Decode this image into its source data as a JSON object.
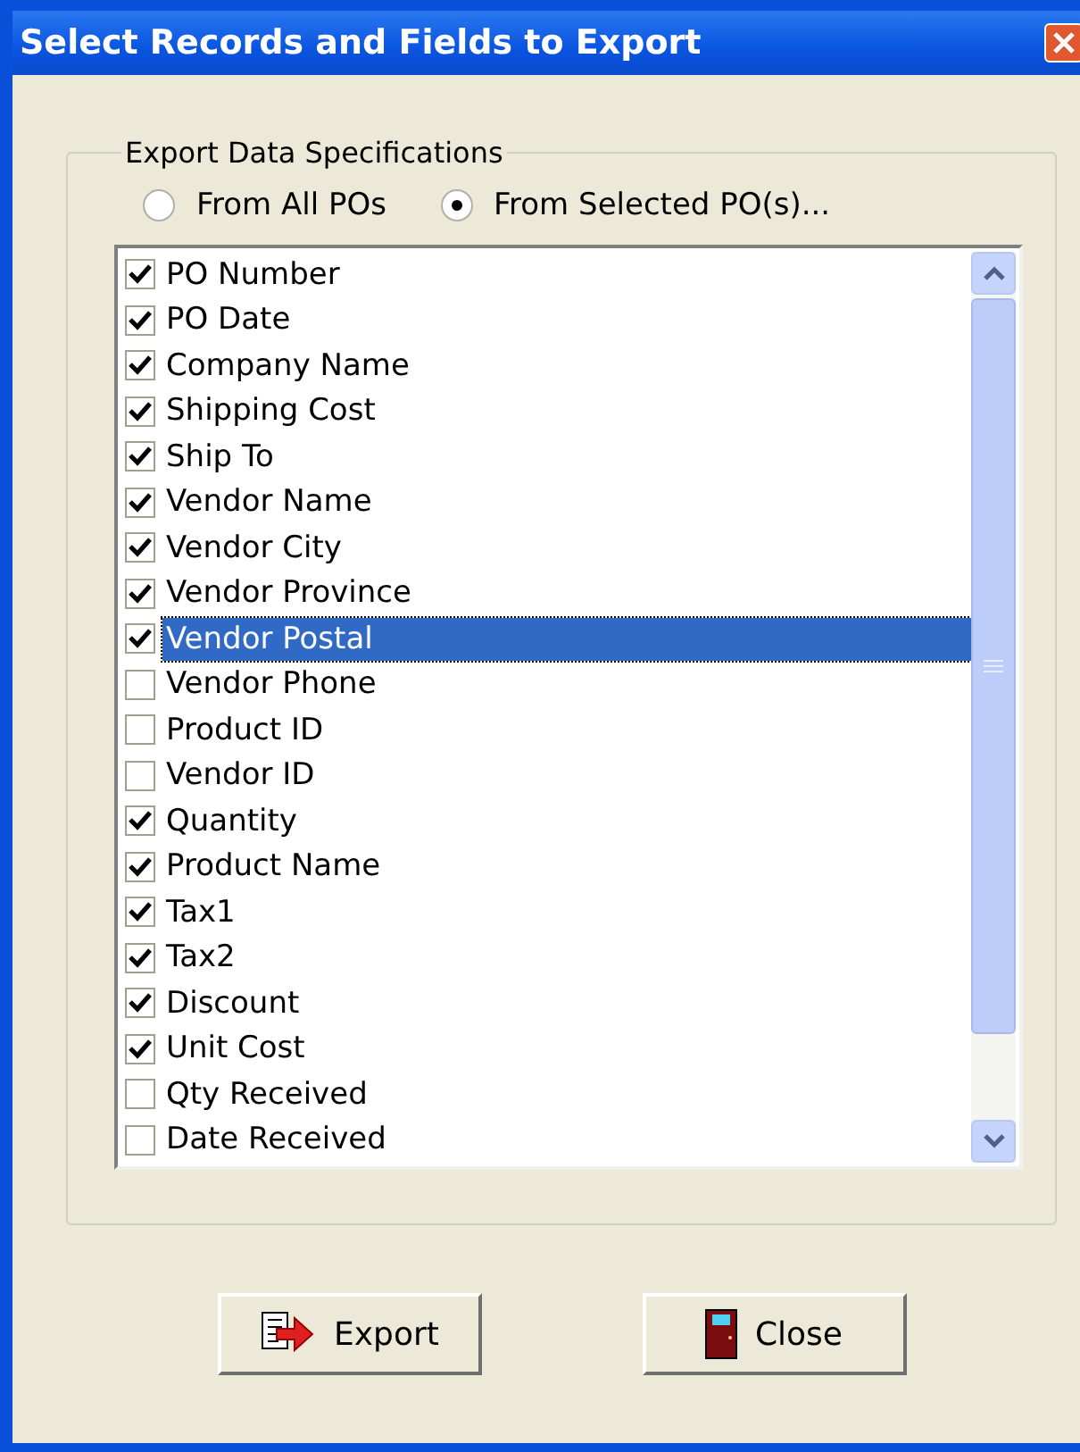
{
  "window": {
    "title": "Select Records and Fields to Export"
  },
  "group": {
    "legend": "Export Data Specifications"
  },
  "radios": [
    {
      "label": "From All POs",
      "selected": false
    },
    {
      "label": "From Selected PO(s)...",
      "selected": true
    }
  ],
  "fields": [
    {
      "label": "PO Number",
      "checked": true,
      "selected": false
    },
    {
      "label": "PO Date",
      "checked": true,
      "selected": false
    },
    {
      "label": "Company Name",
      "checked": true,
      "selected": false
    },
    {
      "label": "Shipping Cost",
      "checked": true,
      "selected": false
    },
    {
      "label": "Ship To",
      "checked": true,
      "selected": false
    },
    {
      "label": "Vendor Name",
      "checked": true,
      "selected": false
    },
    {
      "label": "Vendor City",
      "checked": true,
      "selected": false
    },
    {
      "label": "Vendor Province",
      "checked": true,
      "selected": false
    },
    {
      "label": "Vendor Postal",
      "checked": true,
      "selected": true
    },
    {
      "label": "Vendor Phone",
      "checked": false,
      "selected": false
    },
    {
      "label": "Product ID",
      "checked": false,
      "selected": false
    },
    {
      "label": "Vendor ID",
      "checked": false,
      "selected": false
    },
    {
      "label": "Quantity",
      "checked": true,
      "selected": false
    },
    {
      "label": "Product Name",
      "checked": true,
      "selected": false
    },
    {
      "label": "Tax1",
      "checked": true,
      "selected": false
    },
    {
      "label": "Tax2",
      "checked": true,
      "selected": false
    },
    {
      "label": "Discount",
      "checked": true,
      "selected": false
    },
    {
      "label": "Unit Cost",
      "checked": true,
      "selected": false
    },
    {
      "label": "Qty Received",
      "checked": false,
      "selected": false
    },
    {
      "label": "Date Received",
      "checked": false,
      "selected": false
    }
  ],
  "buttons": [
    {
      "label": "Export",
      "kind": "export"
    },
    {
      "label": "Close",
      "kind": "close"
    }
  ]
}
